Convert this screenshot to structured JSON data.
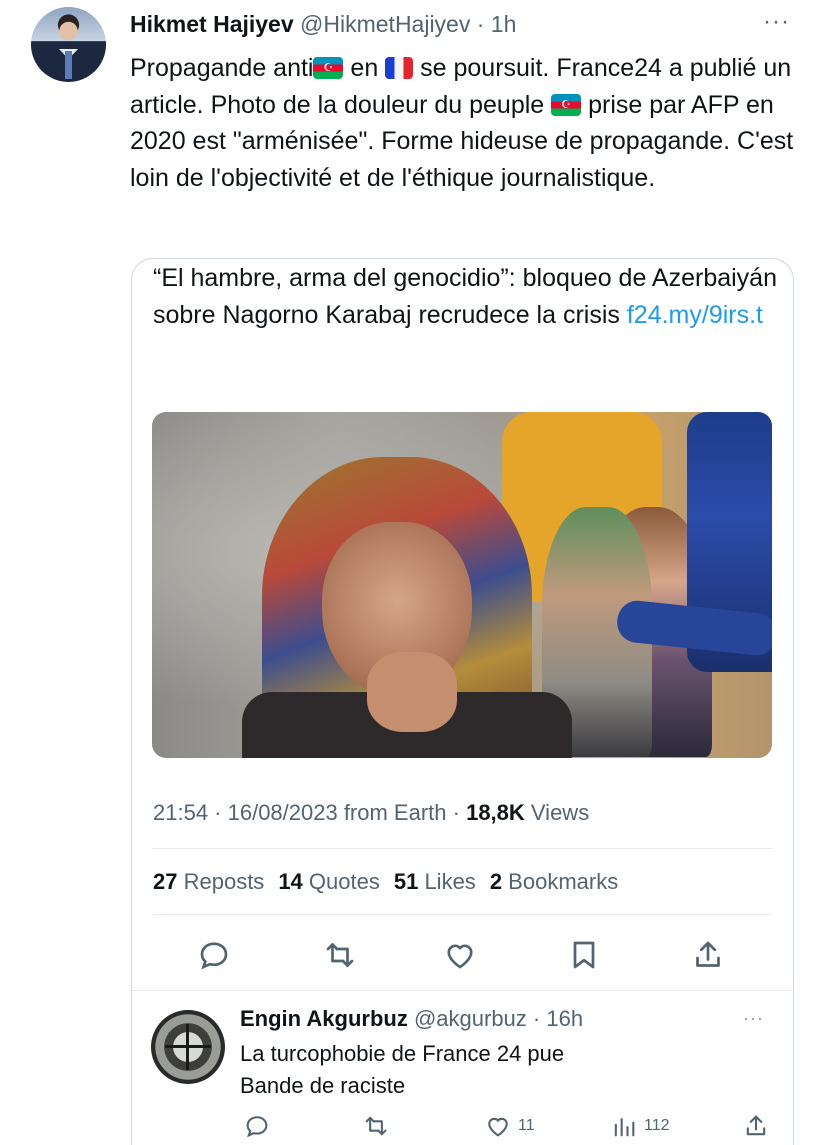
{
  "tweet": {
    "author_name": "Hikmet Hajiyev",
    "author_meta": "@HikmetHajiyev · 1h",
    "more_icon": "more-horizontal-icon",
    "text_1": "Propagande anti",
    "text_2": " en ",
    "text_3": " se poursuit. France24 a publié un article. Photo de la douleur du peuple ",
    "text_4": " prise par AFP en 2020 est \"arménisée\". Forme hideuse de propagande. C'est loin de l'objectivité et de l'éthique journalistique.",
    "flags": [
      "azerbaijan-flag-icon",
      "france-flag-icon",
      "azerbaijan-flag-icon"
    ]
  },
  "quoted": {
    "headline": "“El hambre, arma del genocidio”: bloqueo de Azerbaiyán sobre Nagorno Karabaj recrudece la crisis ",
    "link": "f24.my/9irs.t",
    "photo_desc": "photo",
    "timestamp": "21:54 · 16/08/2023 from Earth · ",
    "views_count": "18,8K",
    "views_label": " Views",
    "stats": {
      "reposts_count": "27",
      "reposts_label": " Reposts",
      "quotes_count": "14",
      "quotes_label": " Quotes",
      "likes_count": "51",
      "likes_label": " Likes",
      "bookmarks_count": "2",
      "bookmarks_label": " Bookmarks"
    },
    "actions": [
      "reply-icon",
      "repost-icon",
      "like-icon",
      "bookmark-icon",
      "share-icon"
    ]
  },
  "reply": {
    "author_name": "Engin Akgurbuz",
    "author_meta": " @akgurbuz · 16h",
    "more": "···",
    "line_1": "La turcophobie de France 24 pue",
    "line_2": "Bande de raciste",
    "likes": "11",
    "views": "112"
  },
  "colors": {
    "text": "#0f1419",
    "muted": "#536471",
    "link": "#1d9bf0",
    "border": "#cfd9de"
  }
}
